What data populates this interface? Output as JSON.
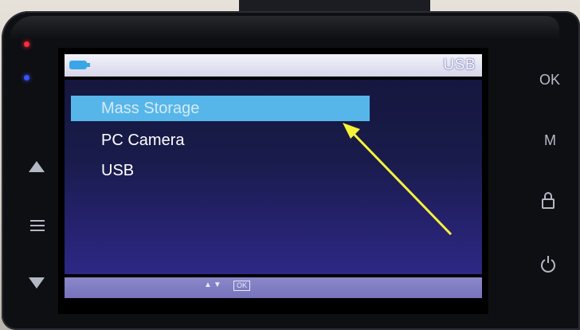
{
  "screen": {
    "title": "USB",
    "header_icon": "battery-icon"
  },
  "menu": {
    "items": [
      {
        "label": "Mass Storage",
        "selected": true
      },
      {
        "label": "PC Camera",
        "selected": false
      },
      {
        "label": "USB",
        "selected": false
      }
    ]
  },
  "footer": {
    "nav_hint": "▲▼",
    "ok_hint": "OK"
  },
  "device_buttons": {
    "left": [
      "up-arrow-icon",
      "menu-icon",
      "down-arrow-icon"
    ],
    "right_ok": "OK",
    "right_m": "M",
    "right_icons": [
      "lock-icon",
      "power-icon"
    ]
  },
  "colors": {
    "selection": "#57b6e9",
    "annotation_arrow": "#f5f23a",
    "title_bar": "#e6e5f5",
    "menu_background": "#1e1d55"
  }
}
